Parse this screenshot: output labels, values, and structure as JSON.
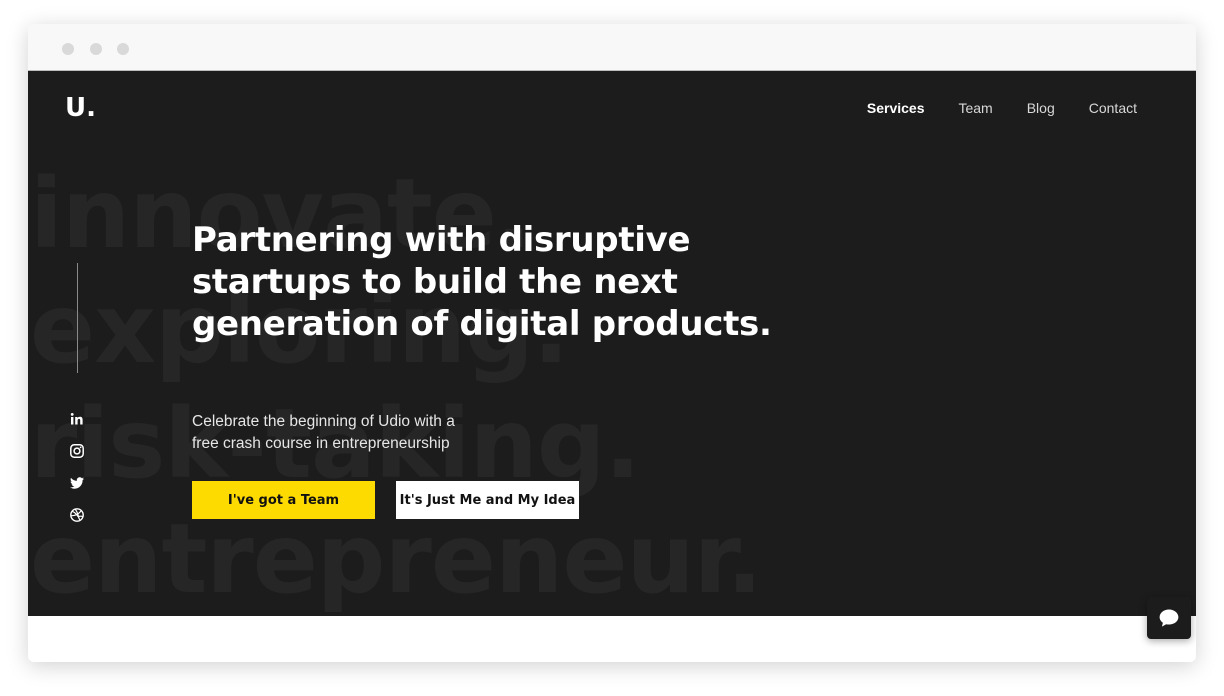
{
  "browser": {
    "window_controls": [
      "window-dot",
      "window-dot",
      "window-dot"
    ]
  },
  "site": {
    "logo": "U."
  },
  "nav": {
    "items": [
      {
        "label": "Services",
        "active": true
      },
      {
        "label": "Team",
        "active": false
      },
      {
        "label": "Blog",
        "active": false
      },
      {
        "label": "Contact",
        "active": false
      }
    ]
  },
  "hero": {
    "background_words": [
      "innovate.",
      "exploring.",
      "risk-taking.",
      "entrepreneur."
    ],
    "headline": "Partnering with disruptive startups to build the next generation of digital products.",
    "subtext": "Celebrate the beginning of Udio with a free crash course in entrepreneurship",
    "primary_button": "I've got a Team",
    "secondary_button": "It's Just Me and My Idea"
  },
  "social": {
    "icons": [
      "linkedin-icon",
      "instagram-icon",
      "twitter-icon",
      "dribbble-icon"
    ]
  },
  "chat": {
    "icon": "chat-bubble-icon"
  },
  "colors": {
    "hero_background": "#1c1c1c",
    "accent_yellow": "#fddb00",
    "text_white": "#ffffff"
  }
}
